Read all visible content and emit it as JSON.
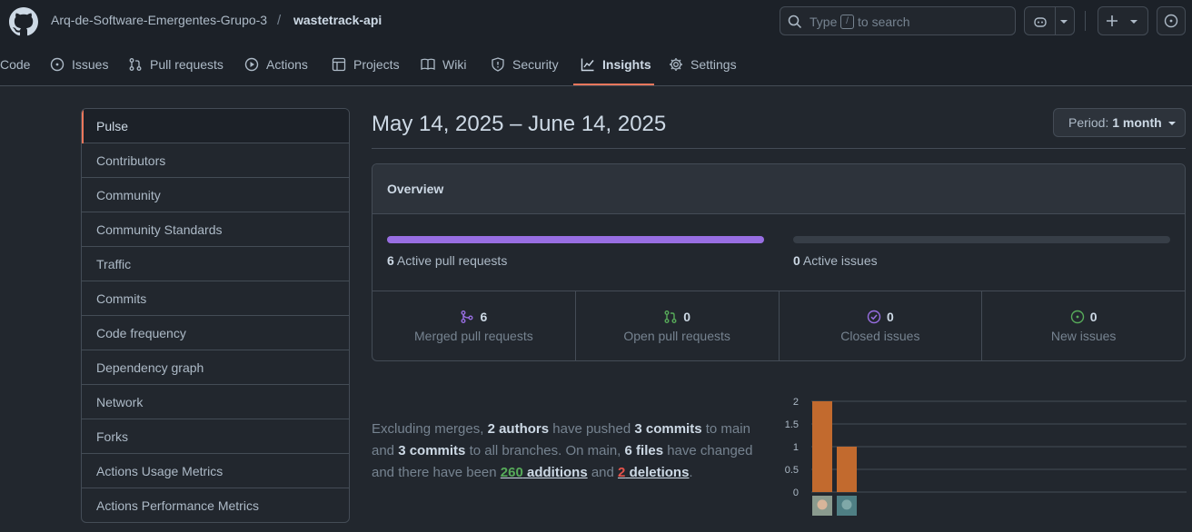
{
  "header": {
    "owner": "Arq-de-Software-Emergentes-Grupo-3",
    "separator": "/",
    "repo": "wastetrack-api",
    "search_placeholder_1": "Type",
    "search_key": "/",
    "search_placeholder_2": "to search"
  },
  "tabs": [
    {
      "label": "Code",
      "icon": "code-icon"
    },
    {
      "label": "Issues",
      "icon": "issue-icon"
    },
    {
      "label": "Pull requests",
      "icon": "pull-request-icon"
    },
    {
      "label": "Actions",
      "icon": "play-icon"
    },
    {
      "label": "Projects",
      "icon": "table-icon"
    },
    {
      "label": "Wiki",
      "icon": "book-icon"
    },
    {
      "label": "Security",
      "icon": "shield-icon"
    },
    {
      "label": "Insights",
      "icon": "graph-icon",
      "active": true
    },
    {
      "label": "Settings",
      "icon": "gear-icon"
    }
  ],
  "sidebar": {
    "items": [
      "Pulse",
      "Contributors",
      "Community",
      "Community Standards",
      "Traffic",
      "Commits",
      "Code frequency",
      "Dependency graph",
      "Network",
      "Forks",
      "Actions Usage Metrics",
      "Actions Performance Metrics"
    ],
    "selected": "Pulse"
  },
  "main": {
    "date_range": "May 14, 2025 – June 14, 2025",
    "period_label": "Period:",
    "period_value": "1 month",
    "overview_title": "Overview",
    "active_prs_count": "6",
    "active_prs_label": "Active pull requests",
    "active_prs_fraction": 1,
    "active_issues_count": "0",
    "active_issues_label": "Active issues",
    "active_issues_fraction": 0,
    "stats": [
      {
        "value": "6",
        "label": "Merged pull requests",
        "icon": "merged-icon",
        "color": "#986ee2"
      },
      {
        "value": "0",
        "label": "Open pull requests",
        "icon": "pull-request-icon",
        "color": "#57ab5a"
      },
      {
        "value": "0",
        "label": "Closed issues",
        "icon": "issue-closed-icon",
        "color": "#986ee2"
      },
      {
        "value": "0",
        "label": "New issues",
        "icon": "issue-opened-icon",
        "color": "#57ab5a"
      }
    ],
    "summary": {
      "t1": "Excluding merges,",
      "authors": "2 authors",
      "t2": "have pushed",
      "commits_main": "3 commits",
      "t3": "to main and",
      "commits_all": "3 commits",
      "t4": "to all branches. On main,",
      "files": "6 files",
      "t5": "have changed and there have been",
      "additions_num": "260",
      "additions_word": "additions",
      "t6": "and",
      "deletions_num": "2",
      "deletions_word": "deletions",
      "t7": "."
    }
  },
  "chart_data": {
    "type": "bar",
    "categories": [
      "author-1",
      "author-2"
    ],
    "values": [
      2,
      1
    ],
    "ylim": [
      0,
      2
    ],
    "yticks": [
      "2",
      "1.5",
      "1",
      "0.5",
      "0"
    ],
    "bar_color": "#c26a2e",
    "grid": true
  }
}
